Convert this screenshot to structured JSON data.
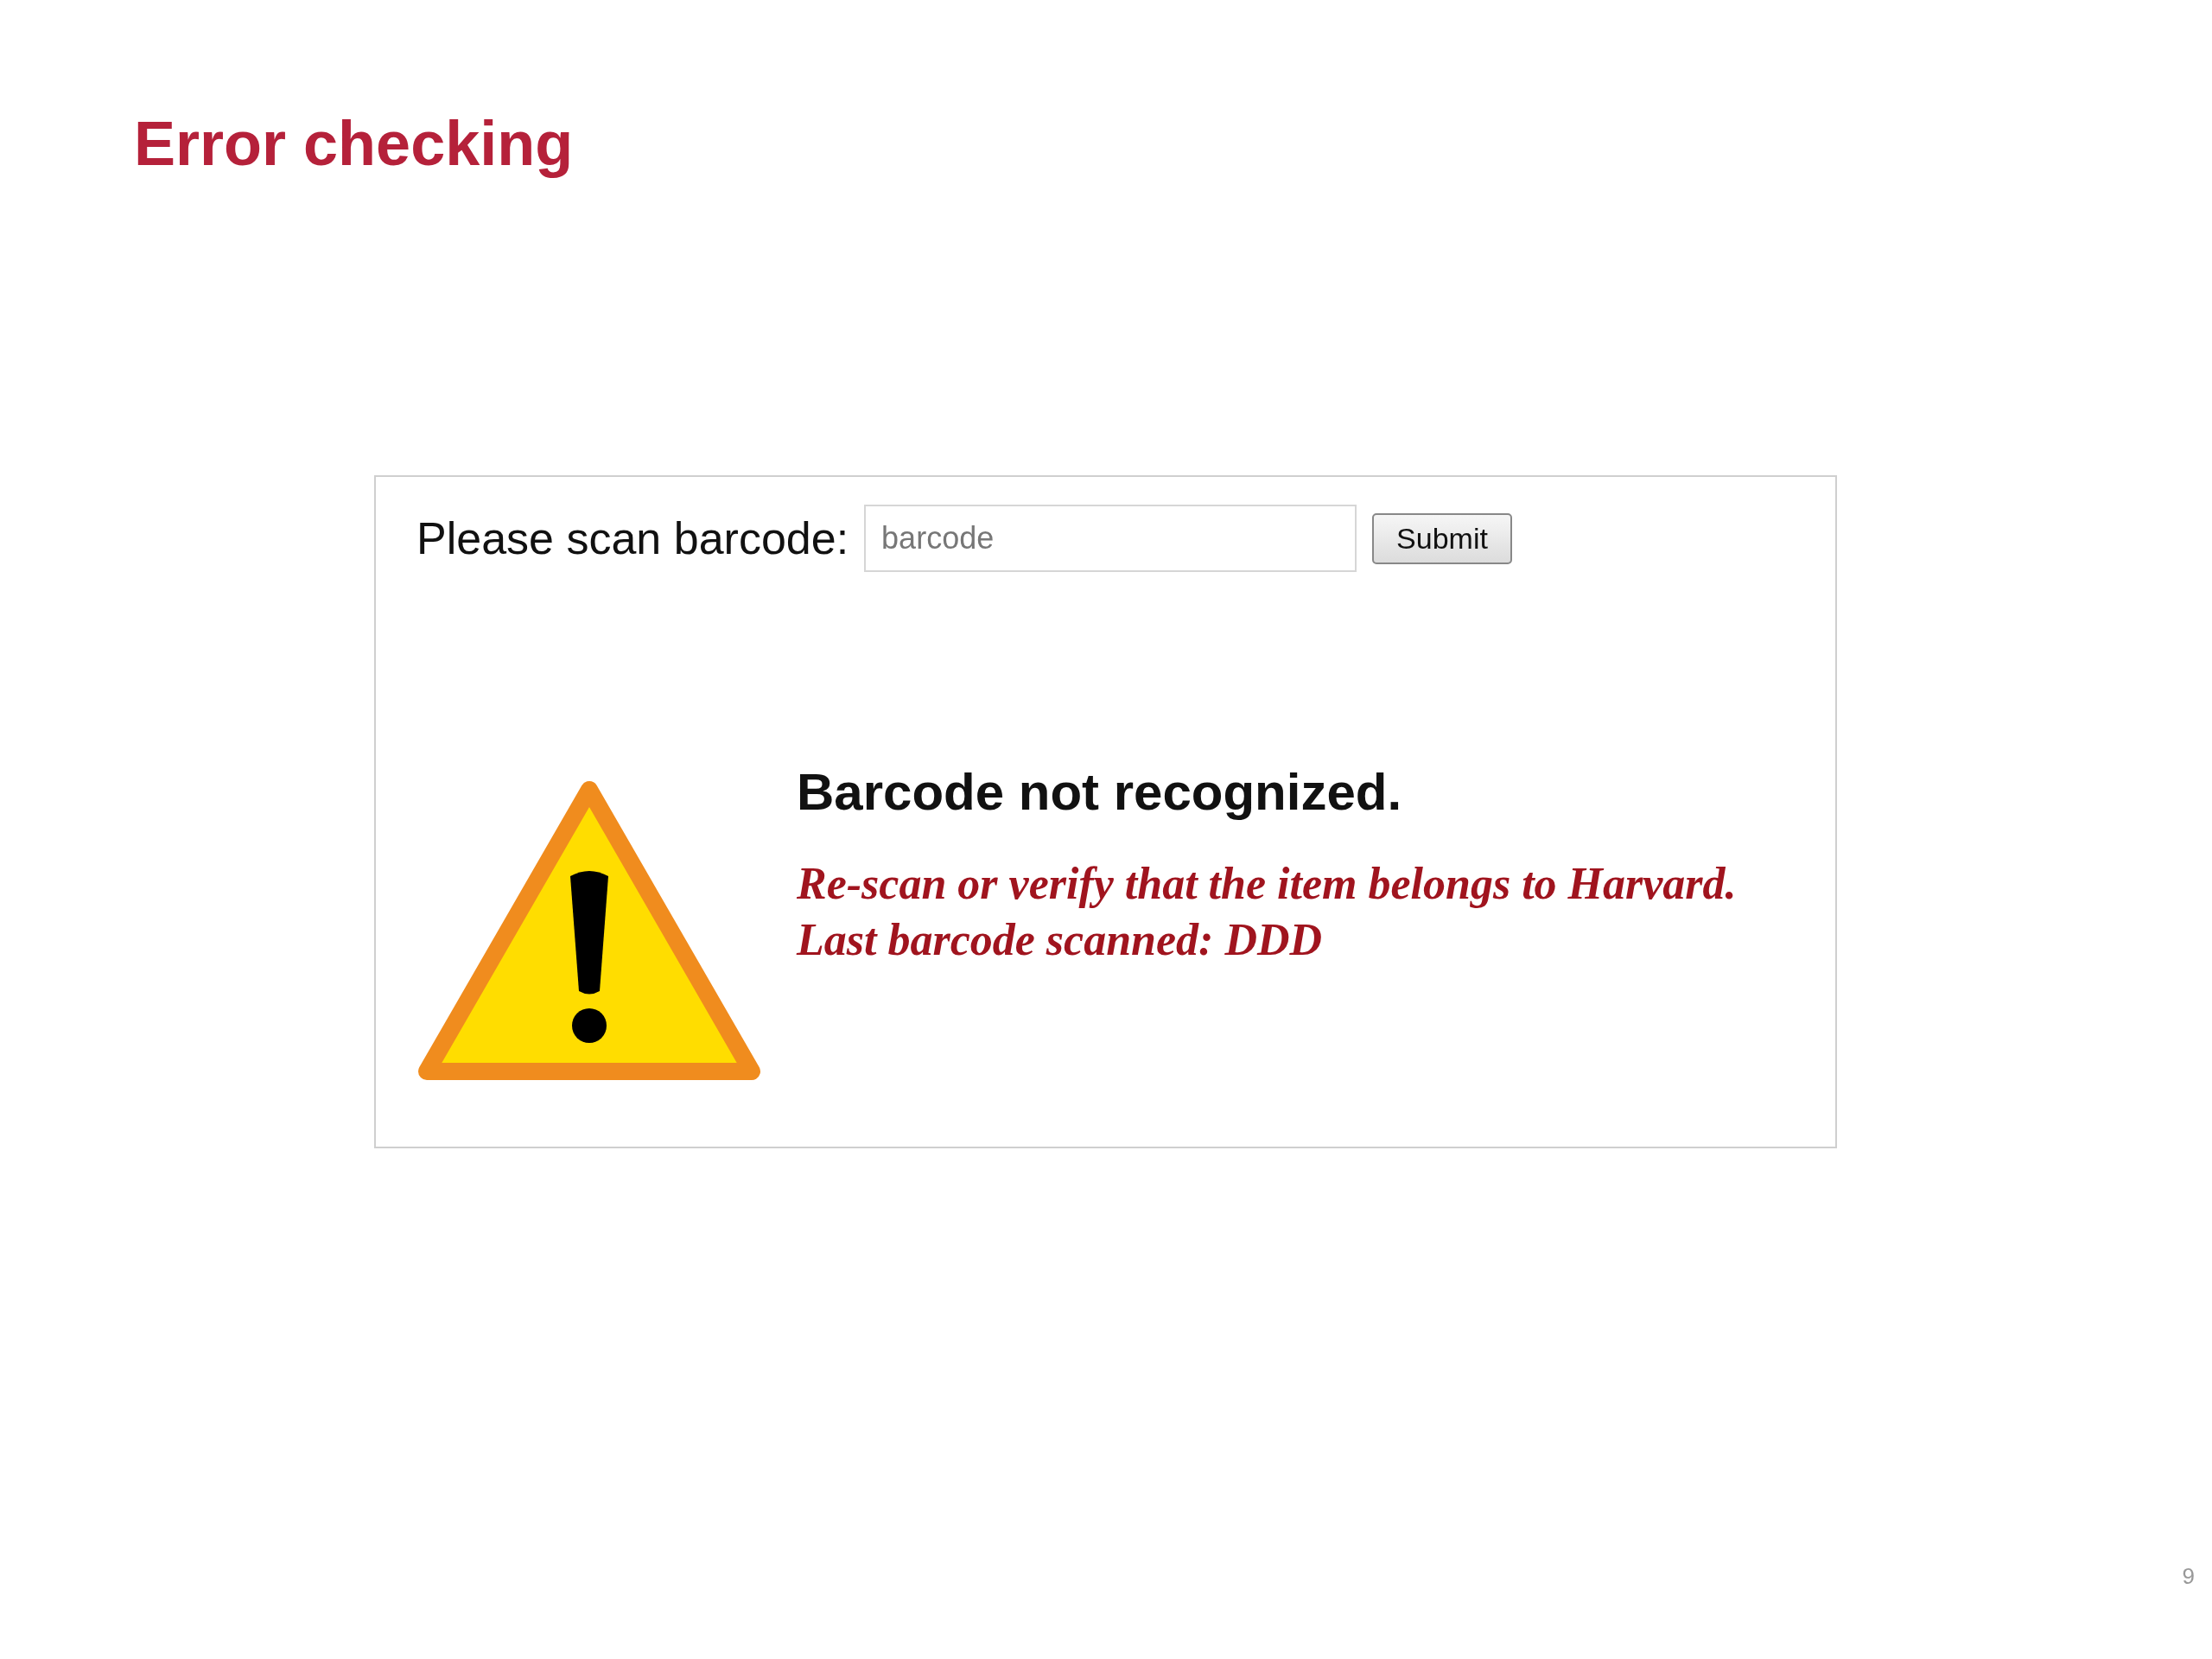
{
  "slide": {
    "title": "Error checking",
    "page_number": "9"
  },
  "scanner": {
    "label": "Please scan barcode:",
    "field": {
      "placeholder": "barcode"
    },
    "button": "Submit"
  },
  "error": {
    "heading": "Barcode not recognized.",
    "lines": [
      "Re-scan or verify that the item belongs to Harvard.",
      "Last barcode scanned: DDD"
    ]
  }
}
